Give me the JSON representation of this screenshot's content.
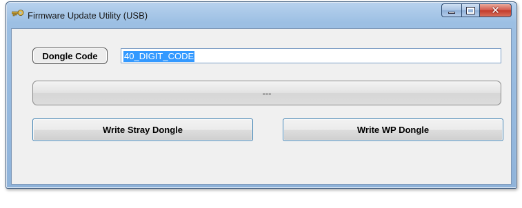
{
  "window": {
    "title": "Firmware Update Utility    (USB)",
    "app_icon": "key-icon",
    "caption_buttons": {
      "minimize": "minimize-icon",
      "maximize": "maximize-icon",
      "close": "close-icon"
    }
  },
  "form": {
    "dongle_code_label": "Dongle Code",
    "dongle_code_value": "40_DIGIT_CODE",
    "status_text": "---"
  },
  "buttons": {
    "write_stray": "Write Stray Dongle",
    "write_wp": "Write WP Dongle"
  },
  "colors": {
    "selection_highlight": "#3399ff",
    "close_button": "#c23a2b",
    "button_focus_border": "#3c7fb1"
  }
}
